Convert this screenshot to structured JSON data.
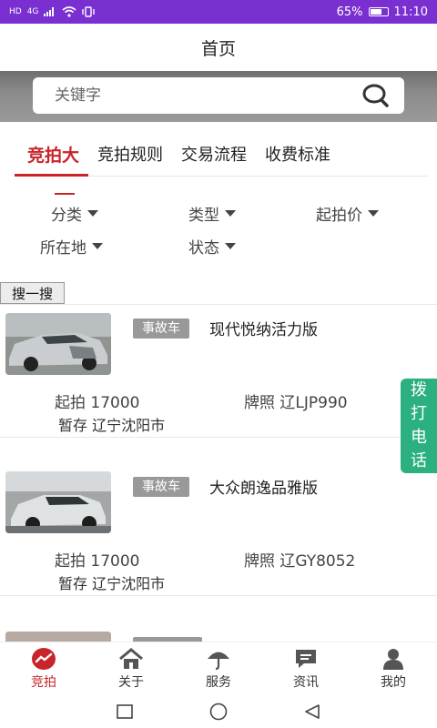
{
  "status_bar": {
    "battery": "65%",
    "time": "11:10",
    "net": "4G"
  },
  "header": {
    "title": "首页"
  },
  "search": {
    "placeholder": "关键字"
  },
  "tabs": [
    {
      "label": "竞拍大",
      "active": true
    },
    {
      "label": "竞拍规则"
    },
    {
      "label": "交易流程"
    },
    {
      "label": "收费标准"
    }
  ],
  "filters": {
    "category": "分类",
    "type": "类型",
    "start_price": "起拍价",
    "location": "所在地",
    "status": "状态"
  },
  "search_button": "搜一搜",
  "listings": [
    {
      "tag": "事故车",
      "title": "现代悦纳活力版",
      "price": "起拍 17000",
      "plate": "牌照 辽LJP990",
      "location": "暂存 辽宁沈阳市"
    },
    {
      "tag": "事故车",
      "title": "大众朗逸品雅版",
      "price": "起拍 17000",
      "plate": "牌照 辽GY8052",
      "location": "暂存 辽宁沈阳市"
    }
  ],
  "call_button": [
    "拨",
    "打",
    "电",
    "话"
  ],
  "bottom_nav": [
    {
      "label": "竞拍",
      "icon": "auction-icon",
      "active": true
    },
    {
      "label": "关于",
      "icon": "home-icon"
    },
    {
      "label": "服务",
      "icon": "umbrella-icon"
    },
    {
      "label": "资讯",
      "icon": "message-icon"
    },
    {
      "label": "我的",
      "icon": "user-icon"
    }
  ],
  "colors": {
    "accent": "#c8242a",
    "status_bar": "#7a2fd0",
    "call": "#2bb07f",
    "tag": "#999999"
  }
}
